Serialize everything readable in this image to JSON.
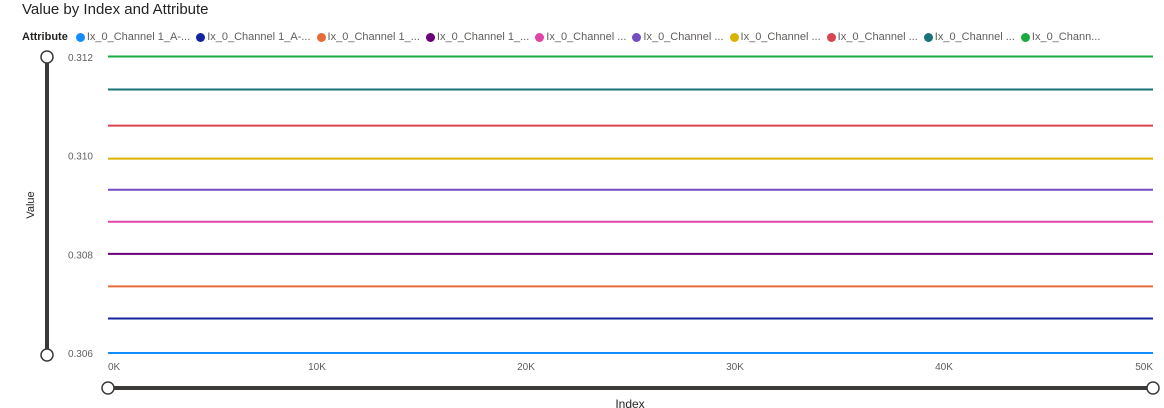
{
  "chart_data": {
    "type": "line",
    "title": "Value by Index and Attribute",
    "xlabel": "Index",
    "ylabel": "Value",
    "legend_title": "Attribute",
    "legend_position": "top-left",
    "xlim": [
      0,
      50000
    ],
    "ylim": [
      0.306,
      0.312
    ],
    "x_ticks": [
      0,
      10000,
      20000,
      30000,
      40000,
      50000
    ],
    "x_tick_labels": [
      "0K",
      "10K",
      "20K",
      "30K",
      "40K",
      "50K"
    ],
    "y_ticks": [
      0.306,
      0.308,
      0.31,
      0.312
    ],
    "y_tick_labels": [
      "0.306",
      "0.308",
      "0.310",
      "0.312"
    ],
    "grid": false,
    "x": [
      0,
      50000
    ],
    "series": [
      {
        "name": "Ix_0_Channel 1_A-...",
        "color": "#118DFF",
        "values": [
          0.306,
          0.306
        ]
      },
      {
        "name": "Ix_0_Channel 1_A-...",
        "color": "#12239E",
        "values": [
          0.3067,
          0.3067
        ]
      },
      {
        "name": "Ix_0_Channel 1_...",
        "color": "#E66C37",
        "values": [
          0.30735,
          0.30735
        ]
      },
      {
        "name": "Ix_0_Channel 1_...",
        "color": "#6B007B",
        "values": [
          0.30801,
          0.30801
        ]
      },
      {
        "name": "Ix_0_Channel ...",
        "color": "#E044A7",
        "values": [
          0.30866,
          0.30866
        ]
      },
      {
        "name": "Ix_0_Channel ...",
        "color": "#744EC2",
        "values": [
          0.30931,
          0.30931
        ]
      },
      {
        "name": "Ix_0_Channel ...",
        "color": "#D9B300",
        "values": [
          0.30994,
          0.30994
        ]
      },
      {
        "name": "Ix_0_Channel ...",
        "color": "#D64550",
        "values": [
          0.31061,
          0.31061
        ]
      },
      {
        "name": "Ix_0_Channel ...",
        "color": "#197278",
        "values": [
          0.31134,
          0.31134
        ]
      },
      {
        "name": "Ix_0_Chann...",
        "color": "#1AAB40",
        "values": [
          0.31201,
          0.31201
        ]
      }
    ]
  }
}
